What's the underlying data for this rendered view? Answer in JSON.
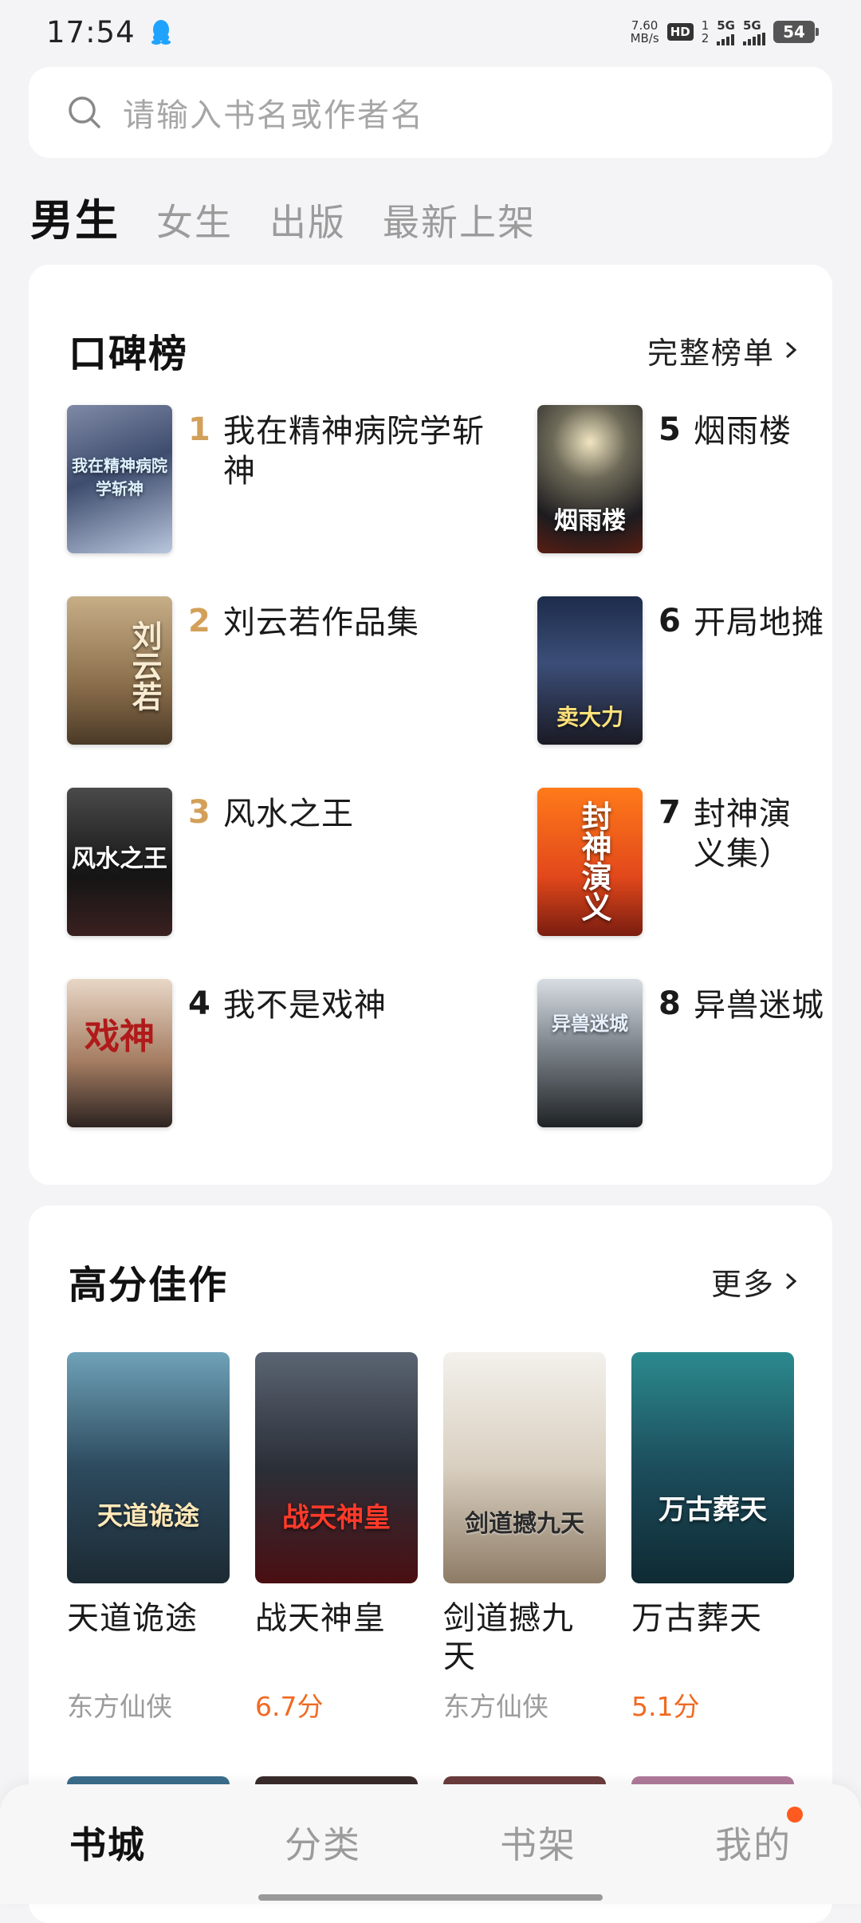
{
  "status_bar": {
    "time": "17:54",
    "net_speed_value": "7.60",
    "net_speed_unit": "MB/s",
    "hd_label": "HD",
    "hd_sim_top": "1",
    "hd_sim_bottom": "2",
    "sig1": "5G",
    "sig2": "5G",
    "battery": "54"
  },
  "search": {
    "placeholder": "请输入书名或作者名"
  },
  "tabs": [
    {
      "label": "男生",
      "active": true
    },
    {
      "label": "女生",
      "active": false
    },
    {
      "label": "出版",
      "active": false
    },
    {
      "label": "最新上架",
      "active": false
    }
  ],
  "ranking": {
    "title": "口碑榜",
    "more": "完整榜单",
    "items": [
      {
        "rank": "1",
        "title": "我在精神病院学斩神",
        "cover_text": "我在精神病院学斩神"
      },
      {
        "rank": "2",
        "title": "刘云若作品集",
        "cover_text": "刘云若"
      },
      {
        "rank": "3",
        "title": "风水之王",
        "cover_text": "风水之王"
      },
      {
        "rank": "4",
        "title": "我不是戏神",
        "cover_text": "戏神"
      },
      {
        "rank": "5",
        "title": "烟雨楼",
        "cover_text": "烟雨楼"
      },
      {
        "rank": "6",
        "title": "开局地摊",
        "cover_text": "卖大力"
      },
      {
        "rank": "7",
        "title": "封神演义集）",
        "cover_text": "封神演义"
      },
      {
        "rank": "8",
        "title": "异兽迷城",
        "cover_text": "异兽迷城"
      }
    ]
  },
  "high_score": {
    "title": "高分佳作",
    "more": "更多",
    "items": [
      {
        "title": "天道诡途",
        "meta": "东方仙侠",
        "is_score": false,
        "cover_text": "天道诡途"
      },
      {
        "title": "战天神皇",
        "meta": "6.7分",
        "is_score": true,
        "cover_text": "战天神皇"
      },
      {
        "title": "剑道撼九天",
        "meta": "东方仙侠",
        "is_score": false,
        "cover_text": "剑道撼九天"
      },
      {
        "title": "万古葬天",
        "meta": "5.1分",
        "is_score": true,
        "cover_text": "万古葬天"
      }
    ]
  },
  "bottom_nav": [
    {
      "label": "书城",
      "active": true,
      "dot": false
    },
    {
      "label": "分类",
      "active": false,
      "dot": false
    },
    {
      "label": "书架",
      "active": false,
      "dot": false
    },
    {
      "label": "我的",
      "active": false,
      "dot": true
    }
  ],
  "colors": {
    "accent_rank": "#d3a05a",
    "score": "#f06a22",
    "badge_dot": "#ff5a1f"
  }
}
